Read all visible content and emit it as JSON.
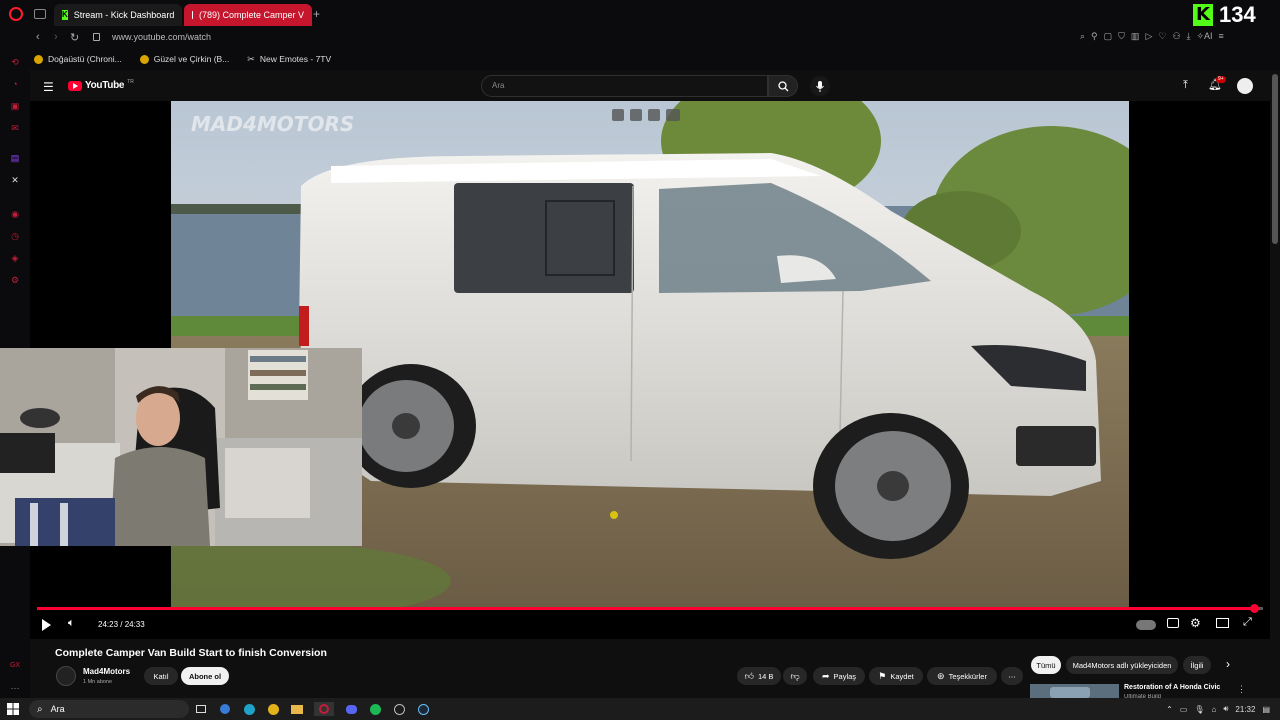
{
  "browser": {
    "tabs": [
      {
        "label": "Stream - Kick Dashboard"
      },
      {
        "label": "(789) Complete Camper V"
      }
    ],
    "url": "www.youtube.com/watch",
    "bookmarks": [
      "Doğaüstü (Chroni...",
      "Güzel ve Çirkin (B...",
      "New Emotes - 7TV"
    ]
  },
  "overlay": {
    "kick_count": "134"
  },
  "youtube": {
    "logo_text": "YouTube",
    "logo_region": "TR",
    "search_placeholder": "Ara",
    "notification_badge": "9+",
    "watermark": "MAD4MOTORS",
    "video_title": "Complete Camper Van Build Start to finish Conversion",
    "time": "24:23 / 24:33",
    "progress": 0.993,
    "channel": {
      "name": "Mad4Motors",
      "subs": "1 Mn abone"
    },
    "join_label": "Katıl",
    "subscribe_label": "Abone ol",
    "likes": "14 B",
    "share_label": "Paylaş",
    "save_label": "Kaydet",
    "thanks_label": "Teşekkürler",
    "chips": [
      "Tümü",
      "Mad4Motors adlı yükleyiciden",
      "İlgili"
    ],
    "recommended_title": "Restoration of A Honda Civic",
    "recommended_subtitle": "Ultimate Build"
  },
  "taskbar": {
    "search_label": "Ara",
    "clock": "21:32"
  },
  "colors": {
    "accent": "#ff0033",
    "kick": "#53fc18",
    "opera": "#c31d3a"
  }
}
